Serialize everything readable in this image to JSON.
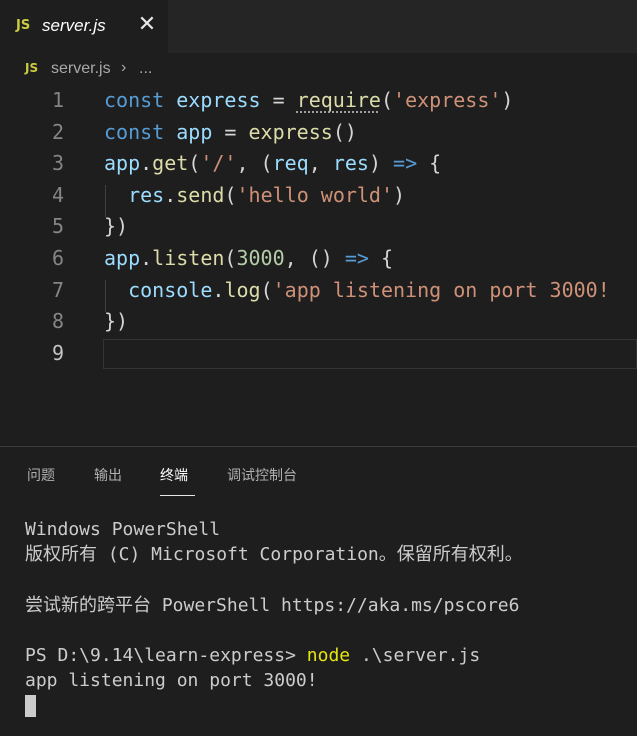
{
  "tab": {
    "badge": "JS",
    "filename": "server.js",
    "close_glyph": "✕"
  },
  "breadcrumb": {
    "badge": "JS",
    "file": "server.js",
    "separator": "›",
    "ellipsis": "..."
  },
  "editor": {
    "lines": [
      {
        "num": "1",
        "tokens": [
          [
            "k",
            "const"
          ],
          [
            "p",
            " "
          ],
          [
            "v",
            "express"
          ],
          [
            "p",
            " = "
          ],
          [
            "f",
            "require"
          ],
          [
            "p",
            "("
          ],
          [
            "s",
            "'express'"
          ],
          [
            "p",
            ")"
          ]
        ]
      },
      {
        "num": "2",
        "tokens": [
          [
            "k",
            "const"
          ],
          [
            "p",
            " "
          ],
          [
            "v",
            "app"
          ],
          [
            "p",
            " = "
          ],
          [
            "f",
            "express"
          ],
          [
            "p",
            "()"
          ]
        ]
      },
      {
        "num": "3",
        "tokens": [
          [
            "v",
            "app"
          ],
          [
            "p",
            "."
          ],
          [
            "f",
            "get"
          ],
          [
            "p",
            "("
          ],
          [
            "s",
            "'/'"
          ],
          [
            "p",
            ", ("
          ],
          [
            "v",
            "req"
          ],
          [
            "p",
            ", "
          ],
          [
            "v",
            "res"
          ],
          [
            "p",
            ") "
          ],
          [
            "k",
            "=>"
          ],
          [
            "p",
            " {"
          ]
        ]
      },
      {
        "num": "4",
        "tokens": [
          [
            "p",
            "  "
          ],
          [
            "v",
            "res"
          ],
          [
            "p",
            "."
          ],
          [
            "f",
            "send"
          ],
          [
            "p",
            "("
          ],
          [
            "s",
            "'hello world'"
          ],
          [
            "p",
            ")"
          ]
        ]
      },
      {
        "num": "5",
        "tokens": [
          [
            "p",
            "})"
          ]
        ]
      },
      {
        "num": "6",
        "tokens": [
          [
            "v",
            "app"
          ],
          [
            "p",
            "."
          ],
          [
            "f",
            "listen"
          ],
          [
            "p",
            "("
          ],
          [
            "n",
            "3000"
          ],
          [
            "p",
            ", () "
          ],
          [
            "k",
            "=>"
          ],
          [
            "p",
            " {"
          ]
        ]
      },
      {
        "num": "7",
        "tokens": [
          [
            "p",
            "  "
          ],
          [
            "v",
            "console"
          ],
          [
            "p",
            "."
          ],
          [
            "f",
            "log"
          ],
          [
            "p",
            "("
          ],
          [
            "s",
            "'app listening on port 3000!"
          ]
        ]
      },
      {
        "num": "8",
        "tokens": [
          [
            "p",
            "})"
          ]
        ]
      },
      {
        "num": "9",
        "tokens": []
      }
    ]
  },
  "panel": {
    "tabs": [
      "问题",
      "输出",
      "终端",
      "调试控制台"
    ],
    "active_tab": "终端"
  },
  "terminal": {
    "line1": "Windows PowerShell",
    "line2": "版权所有 (C) Microsoft Corporation。保留所有权利。",
    "line3": "",
    "line4": "尝试新的跨平台 PowerShell https://aka.ms/pscore6",
    "line5": "",
    "prompt": "PS D:\\9.14\\learn-express> ",
    "command": "node",
    "args": " .\\server.js",
    "output": "app listening on port 3000!"
  },
  "colors": {
    "js_badge": "#cbcb41",
    "keyword": "#569cd6",
    "variable": "#9cdcfe",
    "function": "#dcdcaa",
    "string": "#ce9178",
    "number": "#b5cea8",
    "command": "#e5e510"
  }
}
